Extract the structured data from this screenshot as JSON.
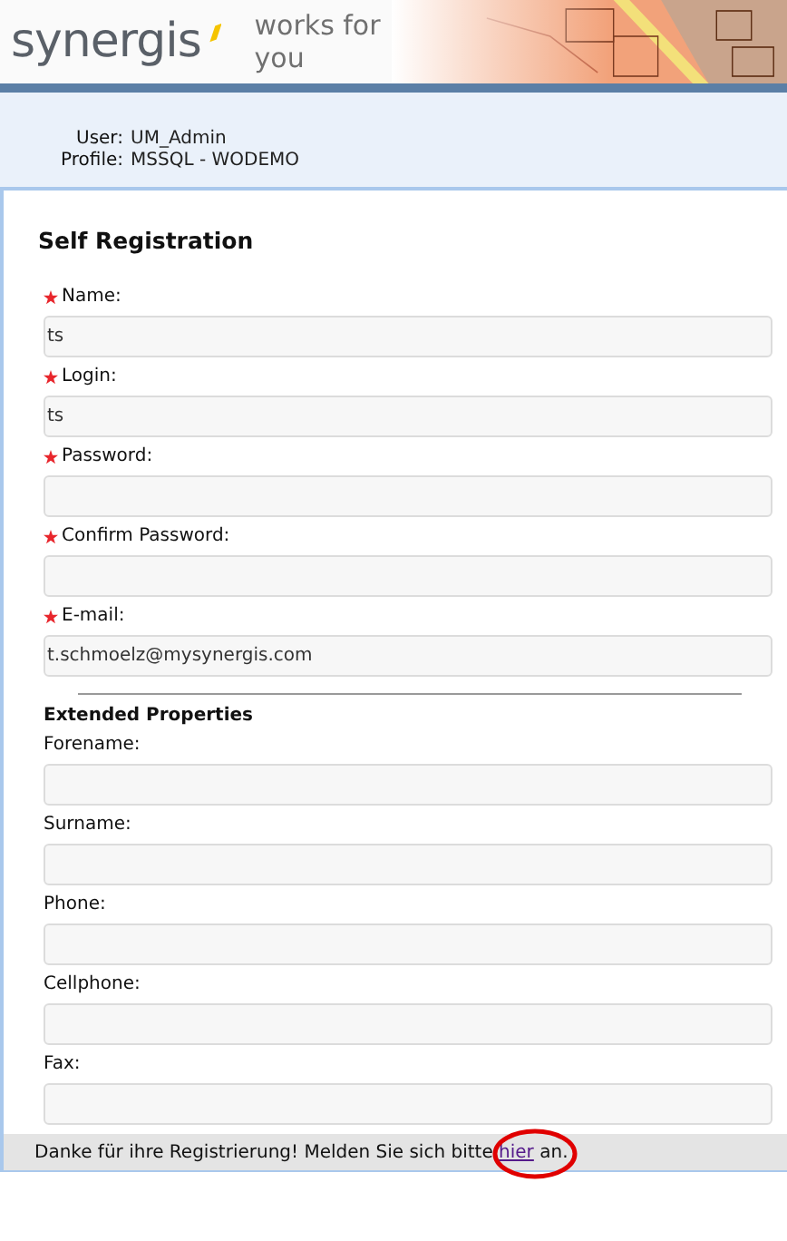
{
  "header": {
    "logo": "synergis",
    "tagline": "works for you"
  },
  "session": {
    "user_label": "User:",
    "user": "UM_Admin",
    "profile_label": "Profile:",
    "profile": "MSSQL - WODEMO"
  },
  "form": {
    "title": "Self Registration",
    "fields": [
      {
        "label": "Name:",
        "required": true,
        "value": "ts"
      },
      {
        "label": "Login:",
        "required": true,
        "value": "ts"
      },
      {
        "label": "Password:",
        "required": true
      },
      {
        "label": "Confirm Password:",
        "required": true
      },
      {
        "label": "E-mail:",
        "required": true,
        "value": "t.schmoelz@mysynergis.com"
      }
    ],
    "extended_title": "Extended Properties",
    "extended_fields": [
      {
        "label": "Forename:",
        "required": false
      },
      {
        "label": "Surname:",
        "required": false
      },
      {
        "label": "Phone:",
        "required": false
      },
      {
        "label": "Cellphone:",
        "required": false
      },
      {
        "label": "Fax:",
        "required": false
      }
    ]
  },
  "footer": {
    "text_before": "Danke für ihre Registrierung! Melden Sie sich bitte",
    "link": "hier",
    "text_after": "an.",
    "link_circled": true
  }
}
